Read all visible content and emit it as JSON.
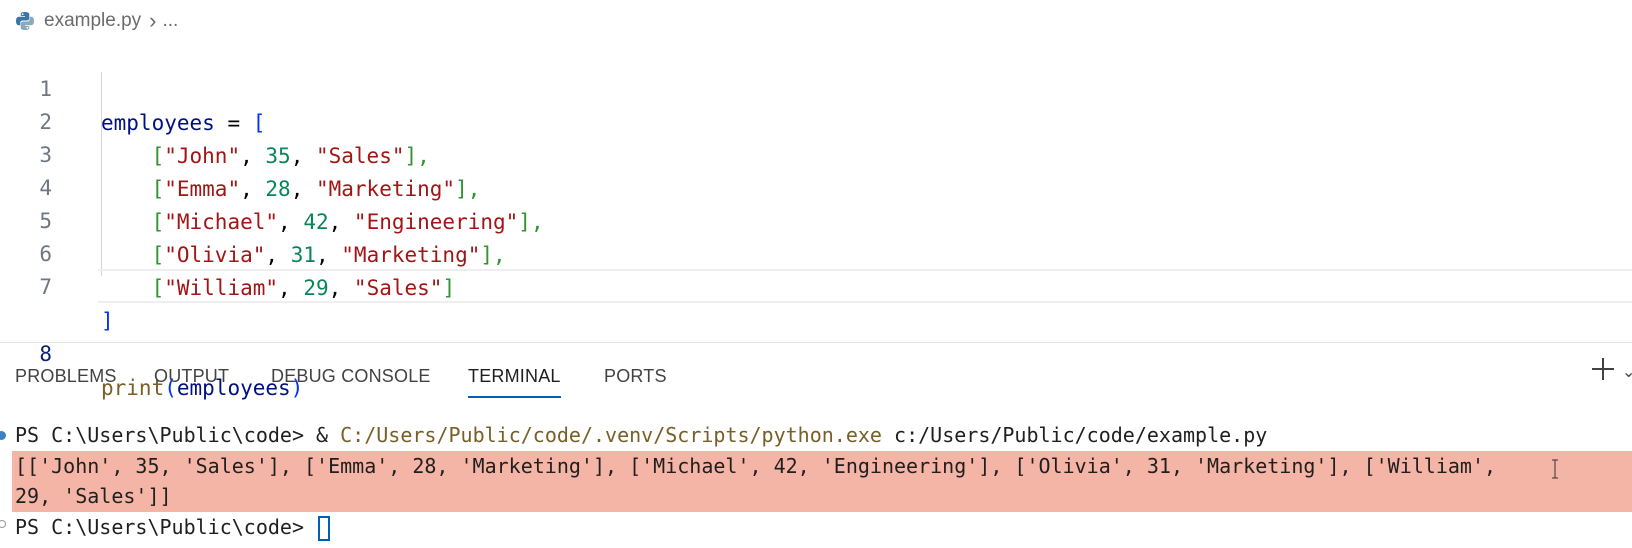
{
  "breadcrumb": {
    "file": "example.py",
    "more": "..."
  },
  "editor": {
    "line_numbers": [
      "1",
      "2",
      "3",
      "4",
      "5",
      "6",
      "7",
      "8"
    ],
    "line1": {
      "name": "employees",
      "eq": " = ",
      "open": "["
    },
    "rows": [
      {
        "name": "\"John\"",
        "age": "35",
        "dept": "\"Sales\"",
        "trail": "],"
      },
      {
        "name": "\"Emma\"",
        "age": "28",
        "dept": "\"Marketing\"",
        "trail": "],"
      },
      {
        "name": "\"Michael\"",
        "age": "42",
        "dept": "\"Engineering\"",
        "trail": "],"
      },
      {
        "name": "\"Olivia\"",
        "age": "31",
        "dept": "\"Marketing\"",
        "trail": "],"
      },
      {
        "name": "\"William\"",
        "age": "29",
        "dept": "\"Sales\"",
        "trail": "]"
      }
    ],
    "line7": "]",
    "line8": {
      "fn": "print",
      "open": "(",
      "arg": "employees",
      "close": ")"
    }
  },
  "panel": {
    "tabs": [
      "PROBLEMS",
      "OUTPUT",
      "DEBUG CONSOLE",
      "TERMINAL",
      "PORTS"
    ],
    "active_tab": "TERMINAL"
  },
  "terminal": {
    "prompt": "PS C:\\Users\\Public\\code> ",
    "amp": "& ",
    "exe": "C:/Users/Public/code/.venv/Scripts/python.exe",
    "arg": " c:/Users/Public/code/example.py",
    "output_line1": "[['John', 35, 'Sales'], ['Emma', 28, 'Marketing'], ['Michael', 42, 'Engineering'], ['Olivia', 31, 'Marketing'], ['William',",
    "output_line2": "29, 'Sales']]",
    "prompt2": "PS C:\\Users\\Public\\code> "
  },
  "colors": {
    "string": "#a31515",
    "number": "#098658",
    "variable": "#001080",
    "bracket1": "#0431fa",
    "bracket2": "#319331",
    "function": "#795e26",
    "output_highlight": "#f4b5a6",
    "accent": "#005fb8"
  }
}
